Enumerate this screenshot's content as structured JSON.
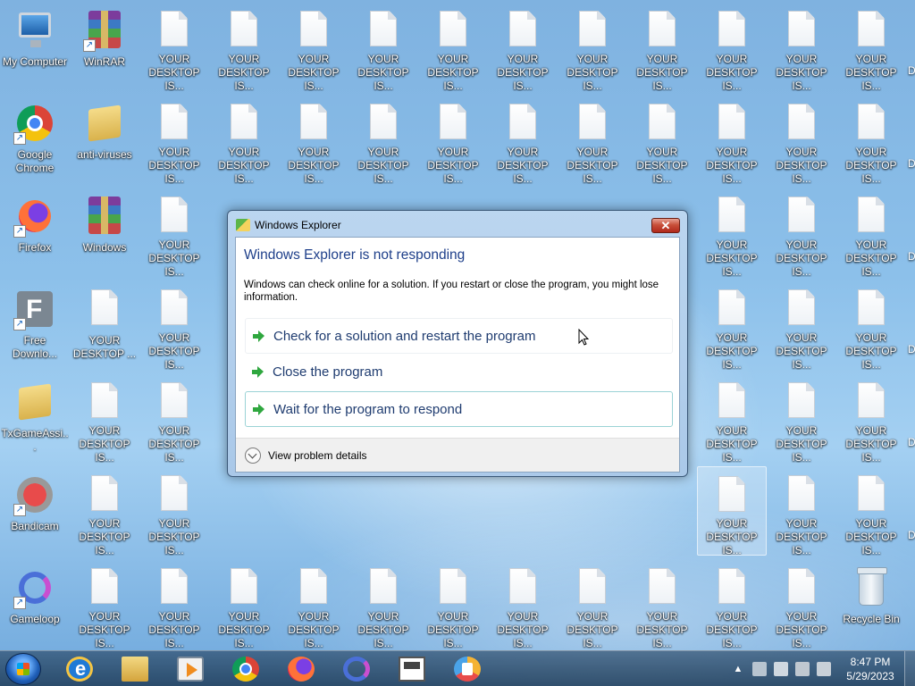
{
  "desktop": {
    "icons": {
      "my_computer": "My Computer",
      "winrar": "WinRAR",
      "google_chrome": "Google Chrome",
      "anti_viruses": "anti-viruses",
      "firefox": "Firefox",
      "windows": "Windows",
      "free_download": "Free Downlo...",
      "txgame": "TxGameAssi...",
      "bandicam": "Bandicam",
      "gameloop": "Gameloop",
      "recycle_bin": "Recycle Bin",
      "ransom_note": "YOUR DESKTOP IS...",
      "ransom_note_alt": "YOUR DESKTOP ...",
      "edge_partial": "D"
    }
  },
  "dialog": {
    "title": "Windows Explorer",
    "close_glyph": "✕",
    "heading": "Windows Explorer is not responding",
    "message": "Windows can check online for a solution. If you restart or close the program, you might lose information.",
    "options": [
      "Check for a solution and restart the program",
      "Close the program",
      "Wait for the program to respond"
    ],
    "details_label": "View problem details"
  },
  "taskbar": {
    "tray_arrow": "▲",
    "clock_time": "8:47 PM",
    "clock_date": "5/29/2023"
  },
  "colors": {
    "heading": "#1e3f8a",
    "option_text": "#1f3c70",
    "close_button": "#c8503a",
    "arrow_green": "#2fa73f"
  }
}
